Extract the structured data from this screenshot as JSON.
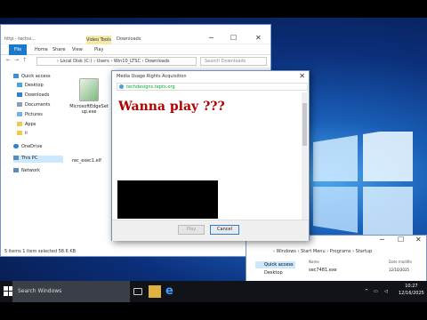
{
  "explorer_main": {
    "title": "Downloads",
    "qat_hint": "http - techsi...",
    "contextual_tab": "Video Tools",
    "ribbon_tabs": [
      "File",
      "Home",
      "Share",
      "View",
      "Play"
    ],
    "address": "› Local Disk (C:) › Users › Win10_LTSC › Downloads",
    "search_placeholder": "Search Downloads",
    "sidebar": [
      "Quick access",
      "Desktop",
      "Downloads",
      "Documents",
      "Pictures",
      "Apps",
      "ii",
      "OneDrive",
      "This PC",
      "Network"
    ],
    "files": [
      {
        "name": "MicrosoftEdgeSetup.exe",
        "label_line1": "MicrosoftEdgeSet",
        "label_line2": "up.exe",
        "icon": "installer-icon"
      },
      {
        "name": "rec_exec1.elf",
        "label_line1": "rec_exec1.elf",
        "icon": "file-icon"
      }
    ],
    "status": "5 items   1 item selected  58.6 KB"
  },
  "explorer_secondary": {
    "address": "› Windows › Start Menu › Programs › Startup",
    "header_name": "Name",
    "header_date": "Date modifie",
    "sidebar_quick_access": "Quick access",
    "sidebar_desktop": "Desktop",
    "file_name": "sec7481.exe",
    "file_date": "12/10/2025"
  },
  "dialog": {
    "title": "Media Usage Rights Acquisition",
    "url": "techdesigns.teptx.org",
    "headline": "Wanna play ???",
    "play_label": "Play",
    "cancel_label": "Cancel"
  },
  "taskbar": {
    "search_placeholder": "Search Windows",
    "time": "10:27",
    "date": "12/16/2025"
  },
  "colors": {
    "accent": "#1979ca",
    "headline": "#b00000",
    "desktop": "#0b2f7a"
  }
}
